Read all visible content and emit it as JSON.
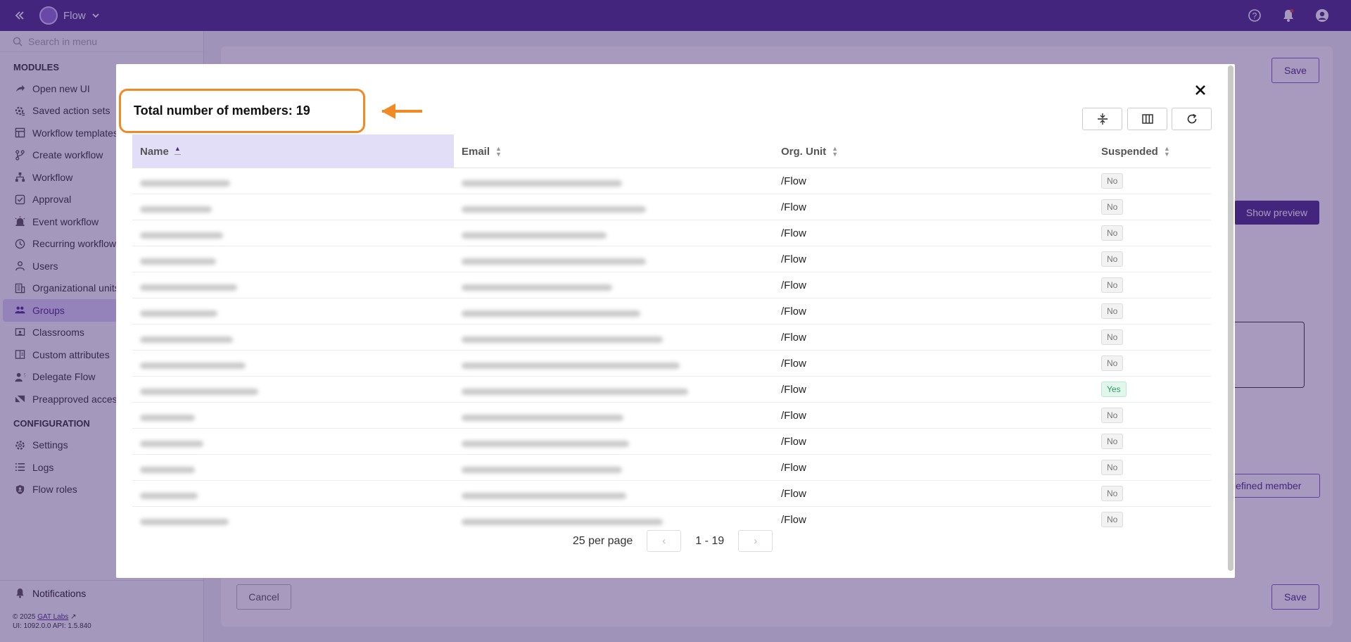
{
  "topbar": {
    "app_name": "Flow",
    "icons": [
      "double-chevron-left-icon",
      "help-icon",
      "bell-icon",
      "account-icon"
    ]
  },
  "sidebar": {
    "search_placeholder": "Search in menu",
    "modules_heading": "MODULES",
    "modules": [
      {
        "label": "Open new UI",
        "icon": "share-icon"
      },
      {
        "label": "Saved action sets",
        "icon": "gear-list-icon"
      },
      {
        "label": "Workflow templates",
        "icon": "template-icon"
      },
      {
        "label": "Create workflow",
        "icon": "branch-icon"
      },
      {
        "label": "Workflow",
        "icon": "hierarchy-icon"
      },
      {
        "label": "Approval",
        "icon": "check-box-icon"
      },
      {
        "label": "Event workflow",
        "icon": "siren-icon"
      },
      {
        "label": "Recurring workflow",
        "icon": "clock-icon"
      },
      {
        "label": "Users",
        "icon": "user-icon"
      },
      {
        "label": "Organizational units",
        "icon": "building-icon"
      },
      {
        "label": "Groups",
        "icon": "group-icon",
        "active": true
      },
      {
        "label": "Classrooms",
        "icon": "classroom-icon"
      },
      {
        "label": "Custom attributes",
        "icon": "attributes-icon"
      },
      {
        "label": "Delegate Flow",
        "icon": "delegate-icon"
      },
      {
        "label": "Preapproved access",
        "icon": "key-icon"
      }
    ],
    "config_heading": "CONFIGURATION",
    "config": [
      {
        "label": "Settings",
        "icon": "gear-icon"
      },
      {
        "label": "Logs",
        "icon": "list-icon"
      },
      {
        "label": "Flow roles",
        "icon": "shield-icon"
      }
    ],
    "notifications_label": "Notifications",
    "copyright_prefix": "© 2025",
    "copyright_link": "GAT Labs",
    "version": "UI: 1092.0.0 API: 1.5.840"
  },
  "background": {
    "save_label": "Save",
    "cancel_label": "Cancel",
    "preview_label": "Show preview",
    "predefined_label": "edefined member"
  },
  "modal": {
    "total_label": "Total number of members: 19",
    "columns": [
      "Name",
      "Email",
      "Org. Unit",
      "Suspended"
    ],
    "rows": [
      {
        "ou": "/Flow",
        "suspended": "No"
      },
      {
        "ou": "/Flow",
        "suspended": "No"
      },
      {
        "ou": "/Flow",
        "suspended": "No"
      },
      {
        "ou": "/Flow",
        "suspended": "No"
      },
      {
        "ou": "/Flow",
        "suspended": "No"
      },
      {
        "ou": "/Flow",
        "suspended": "No"
      },
      {
        "ou": "/Flow",
        "suspended": "No"
      },
      {
        "ou": "/Flow",
        "suspended": "No"
      },
      {
        "ou": "/Flow",
        "suspended": "Yes"
      },
      {
        "ou": "/Flow",
        "suspended": "No"
      },
      {
        "ou": "/Flow",
        "suspended": "No"
      },
      {
        "ou": "/Flow",
        "suspended": "No"
      },
      {
        "ou": "/Flow",
        "suspended": "No"
      },
      {
        "ou": "/Flow",
        "suspended": "No"
      }
    ],
    "per_page": "25 per page",
    "range": "1 - 19",
    "toolbar_icons": [
      "density-icon",
      "columns-icon",
      "refresh-icon"
    ]
  }
}
